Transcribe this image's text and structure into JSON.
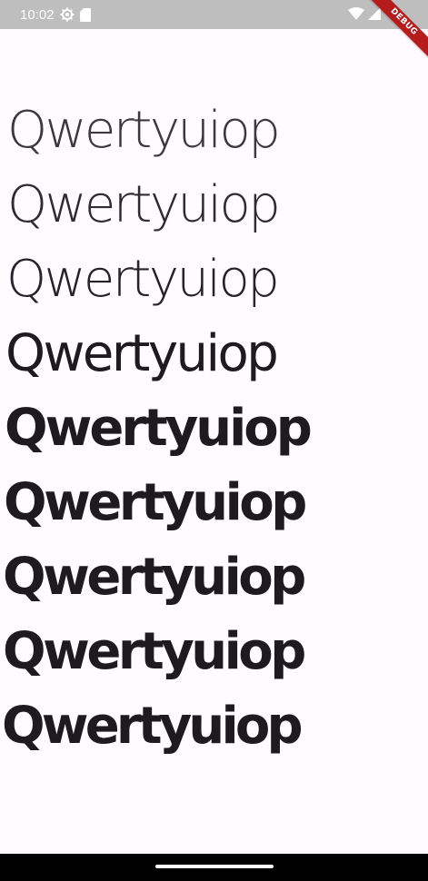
{
  "status_bar": {
    "time": "10:02",
    "left_icons": [
      "settings-icon",
      "sd-card-icon"
    ],
    "right_icons": [
      "wifi-icon",
      "cellular-signal-icon"
    ],
    "background": "#bebebe"
  },
  "debug_banner": {
    "label": "DEBUG",
    "color": "#b71c1c"
  },
  "samples": [
    {
      "text": "Qwertyuiop",
      "weight": "100"
    },
    {
      "text": "Qwertyuiop",
      "weight": "200"
    },
    {
      "text": "Qwertyuiop",
      "weight": "300"
    },
    {
      "text": "Qwertyuiop",
      "weight": "400"
    },
    {
      "text": "Qwertyuiop",
      "weight": "500"
    },
    {
      "text": "Qwertyuiop",
      "weight": "600"
    },
    {
      "text": "Qwertyuiop",
      "weight": "700"
    },
    {
      "text": "Qwertyuiop",
      "weight": "800"
    },
    {
      "text": "Qwertyuiop",
      "weight": "900"
    }
  ],
  "navigation_bar": {
    "handle": "home-gesture-handle",
    "background": "#000000"
  }
}
